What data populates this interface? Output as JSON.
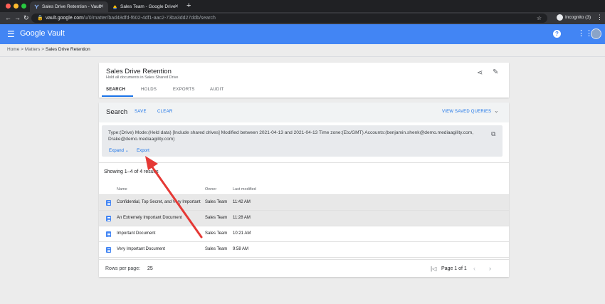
{
  "browser": {
    "tabs": [
      {
        "title": "Sales Drive Retention - Vault",
        "active": true
      },
      {
        "title": "Sales Team - Google Drive",
        "active": false
      }
    ],
    "new_tab": "+",
    "url_host": "vault.google.com",
    "url_path": "/u/0/matter/bad48dfd-f602-4df1-aac2-73ba3dd27ddb/search",
    "profile_label": "Incognito (3)"
  },
  "app": {
    "brand_google": "Google",
    "brand_vault": "Vault",
    "accent_color": "#4285f4"
  },
  "breadcrumb": {
    "items": [
      "Home",
      "Matters",
      "Sales Drive Retention"
    ],
    "separator": ">"
  },
  "matter": {
    "title": "Sales Drive Retention",
    "description": "Hold all documents in Sales Shared Drive",
    "tabs": [
      "SEARCH",
      "HOLDS",
      "EXPORTS",
      "AUDIT"
    ],
    "active_tab": "SEARCH"
  },
  "search": {
    "title": "Search",
    "save_label": "SAVE",
    "clear_label": "CLEAR",
    "view_saved_label": "VIEW SAVED QUERIES",
    "query_text": "Type:(Drive) Mode:(Held data) [Include shared drives] Modified between 2021-04-13 and 2021-04-13 Time zone:(Etc/GMT) Accounts:(benjamin.shenk@demo.mediaagility.com, Drake@demo.mediaagility.com)",
    "expand_label": "Expand",
    "export_label": "Export",
    "results_count": "Showing 1–4 of 4 results"
  },
  "table": {
    "columns": [
      "Name",
      "Owner",
      "Last modified"
    ],
    "rows": [
      {
        "name": "Confidential, Top Secret, and Very Important",
        "owner": "Sales Team",
        "modified": "11:42 AM"
      },
      {
        "name": "An Extremely Important Document",
        "owner": "Sales Team",
        "modified": "11:28 AM"
      },
      {
        "name": "Important Document",
        "owner": "Sales Team",
        "modified": "10:21 AM"
      },
      {
        "name": "Very Important Document",
        "owner": "Sales Team",
        "modified": "9:58 AM"
      }
    ]
  },
  "pagination": {
    "rows_per_page_label": "Rows per page:",
    "rows_per_page_value": "25",
    "page_label": "Page 1 of 1"
  },
  "annotation": {
    "arrow_color": "#e53935"
  }
}
